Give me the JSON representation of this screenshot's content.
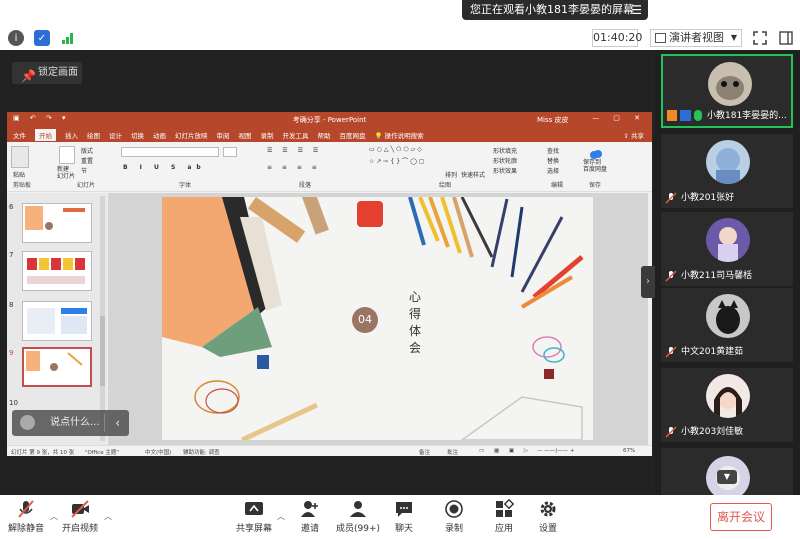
{
  "banner": {
    "text": "您正在观看小教181李晏晏的屏幕"
  },
  "timer": "01:40:20",
  "view_mode": "演讲者视图",
  "lock_screen": "锁定画面",
  "ppt": {
    "title": "考确分享 - PowerPoint",
    "user": "Miss 皮皮",
    "tabs": [
      "文件",
      "开始",
      "插入",
      "绘图",
      "设计",
      "切换",
      "动画",
      "幻灯片放映",
      "审阅",
      "视图",
      "录制",
      "开发工具",
      "帮助",
      "百度网盘",
      "操作说明搜索"
    ],
    "active_tab": "开始",
    "share": "共享",
    "ribbon_groups": [
      "剪贴板",
      "幻灯片",
      "字体",
      "段落",
      "绘图",
      "编辑",
      "保存"
    ],
    "ribbon_items": {
      "paste": "粘贴",
      "new_slide": "新建\n幻灯片",
      "layout": "版式",
      "reset": "重置",
      "section": "节",
      "arrange": "排列",
      "quick_styles": "快速样式",
      "shape_fill": "形状填充",
      "shape_outline": "形状轮廓",
      "shape_effects": "形状效果",
      "find": "查找",
      "replace": "替换",
      "select": "选择",
      "save_baidu": "保存到\n百度网盘"
    },
    "slide_numbers": [
      "6",
      "7",
      "8",
      "9",
      "10"
    ],
    "selected_slide": "9",
    "slide": {
      "number": "04",
      "vertical_text": "心得体会"
    },
    "status": {
      "slide_info": "幻灯片 第 9 张，共 10 张",
      "theme": "\"Office 主题\"",
      "lang": "中文(中国)",
      "accessibility": "辅助功能: 调查",
      "notes": "备注",
      "comments": "批注",
      "zoom": "67%"
    }
  },
  "chat_placeholder": "说点什么...",
  "participants": [
    {
      "name": "小教181李晏晏的...",
      "presenting": true
    },
    {
      "name": "小教201张好"
    },
    {
      "name": "小教211司马馨栝"
    },
    {
      "name": "中文201黄建茹"
    },
    {
      "name": "小教203刘佳敏"
    }
  ],
  "toolbar": {
    "unmute": "解除静音",
    "start_video": "开启视频",
    "share_screen": "共享屏幕",
    "invite": "邀请",
    "members": "成员(99+)",
    "chat": "聊天",
    "record": "录制",
    "apps": "应用",
    "settings": "设置",
    "leave": "离开会议"
  },
  "colors": {
    "ppt_accent": "#b7472a",
    "active_speaker": "#23c25a",
    "leave": "#e05a4f",
    "slide_badge": "#9a7563"
  }
}
